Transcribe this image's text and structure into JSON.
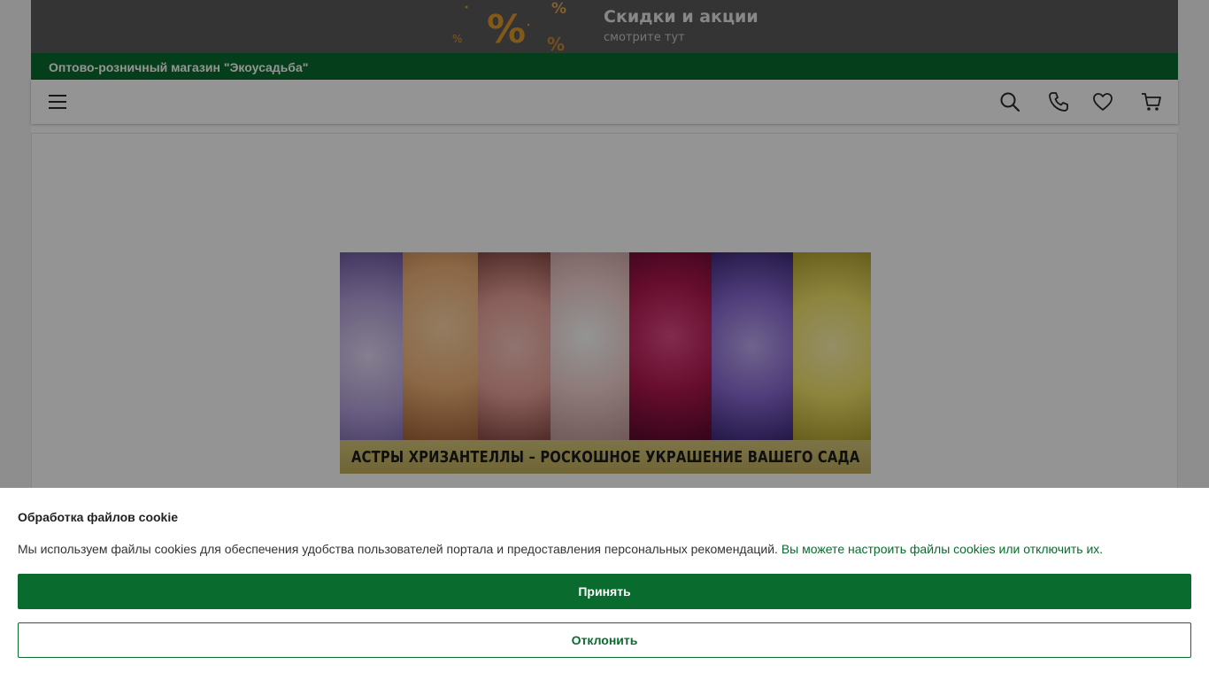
{
  "promo": {
    "title": "Скидки и акции",
    "subtitle": "смотрите тут",
    "graphic_glyph": "%",
    "accent_color": "#e09a2a"
  },
  "shop": {
    "name": "Оптово-розничный магазин \"Экоусадьба\"",
    "brand_color": "#0a6b2e"
  },
  "header": {
    "icons": [
      "menu-icon",
      "search-icon",
      "phone-icon",
      "heart-icon",
      "cart-icon"
    ]
  },
  "hero": {
    "caption": "АСТРЫ ХРИЗАНТЕЛЛЫ – РОСКОШНОЕ УКРАШЕНИЕ ВАШЕГО САДА",
    "flower_colors": [
      "#c9b8e6",
      "#f1b47a",
      "#eca39b",
      "#f3d2d0",
      "#b0164f",
      "#8a69d4",
      "#f3e46b"
    ]
  },
  "cookie": {
    "title": "Обработка файлов cookie",
    "text": "Мы используем файлы cookies для обеспечения удобства пользователей портала и предоставления персональных рекомендаций.",
    "link_text": "Вы можете настроить файлы cookies или отключить их.",
    "accept_label": "Принять",
    "decline_label": "Отклонить"
  }
}
